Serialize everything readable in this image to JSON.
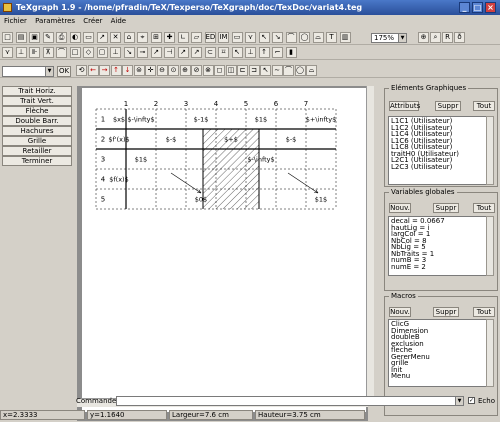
{
  "window": {
    "title": "TeXgraph 1.9 - /home/pfradin/TeX/Texperso/TeXgraph/doc/TexDoc/variat4.teg"
  },
  "menu": {
    "items": [
      "Fichier",
      "Paramètres",
      "Créer",
      "Aide"
    ]
  },
  "toolbar1": {
    "zoom": "175%",
    "buttons": [
      "new",
      "open",
      "save",
      "saveas",
      "print",
      "a",
      "b",
      "c",
      "d",
      "e",
      "f",
      "g",
      "h",
      "i",
      "j",
      "k",
      "l",
      "m",
      "n",
      "o",
      "p",
      "q",
      "r",
      "s",
      "t",
      "u",
      "v",
      "w",
      "x",
      "y",
      "z"
    ]
  },
  "toolbar2": {
    "buttons": [
      "b1",
      "b2",
      "b3",
      "b4",
      "b5",
      "b6",
      "b7",
      "b8",
      "b9",
      "b10",
      "b11",
      "b12",
      "b13",
      "b14",
      "b15",
      "b16"
    ]
  },
  "toolbar3": {
    "ok": "OK",
    "label": "67"
  },
  "left_panel": {
    "buttons": [
      "Trait Horiz.",
      "Trait Vert.",
      "Flèche",
      "Double Barr.",
      "Hachures",
      "Grille",
      "Retailler",
      "Terminer"
    ]
  },
  "graphic_elements": {
    "title": "Eléments Graphiques",
    "attributs": "Attributs",
    "suppr": "Suppr",
    "tout": "Tout",
    "items": [
      "L1C1 (Utilisateur)",
      "L1C2 (Utilisateur)",
      "L1C4 (Utilisateur)",
      "L1C6 (Utilisateur)",
      "L1C8 (Utilisateur)",
      "traitH0 (Utilisateur)",
      "L2C1 (Utilisateur)",
      "L2C3 (Utilisateur)"
    ]
  },
  "global_vars": {
    "title": "Variables globales",
    "nouv": "Nouv.",
    "suppr": "Suppr",
    "tout": "Tout",
    "items": [
      "decal = 0.0667",
      "hautLig = i",
      "largCol = 1",
      "NbCol = 8",
      "NbLig = 5",
      "NbTraits = 1",
      "numB = 3",
      "numE = 2"
    ]
  },
  "macros": {
    "title": "Macros",
    "nouv": "Nouv.",
    "suppr": "Suppr",
    "tout": "Tout",
    "items": [
      "ClicG",
      "Dimension",
      "doubleB",
      "exclusion",
      "fleche",
      "GererMenu",
      "grille",
      "Init",
      "Menu"
    ]
  },
  "command": {
    "label": "Commande =",
    "value": "",
    "echo": "Echo"
  },
  "status": {
    "x": "x=2.3333",
    "y": "y=1.1640",
    "width": "Largeur=7.6 cm",
    "height": "Hauteur=3.75 cm"
  },
  "table": {
    "col_headers": [
      "1",
      "2",
      "3",
      "4",
      "5",
      "6",
      "7"
    ],
    "row_headers": [
      "1",
      "2",
      "3",
      "4",
      "5"
    ],
    "cells": [
      {
        "r": 1,
        "c": 1,
        "t": "$x$"
      },
      {
        "r": 1,
        "c": 2,
        "t": "$-\\infty$"
      },
      {
        "r": 1,
        "c": 4,
        "t": "$-1$"
      },
      {
        "r": 1,
        "c": 6,
        "t": "$1$"
      },
      {
        "r": 1,
        "c": 8,
        "t": "$+\\infty$"
      },
      {
        "r": 2,
        "c": 1,
        "t": "$f'(x)$"
      },
      {
        "r": 2,
        "c": 3,
        "t": "$-$"
      },
      {
        "r": 2,
        "c": 5,
        "t": "$+$"
      },
      {
        "r": 2,
        "c": 7,
        "t": "$-$"
      },
      {
        "r": 3,
        "c": 2,
        "t": "$1$"
      },
      {
        "r": 3,
        "c": 6,
        "t": "$-\\infty$"
      },
      {
        "r": 4,
        "c": 1,
        "t": "$f(x)$"
      },
      {
        "r": 5,
        "c": 4,
        "t": "$0$"
      },
      {
        "r": 5,
        "c": 8,
        "t": "$1$"
      }
    ]
  }
}
